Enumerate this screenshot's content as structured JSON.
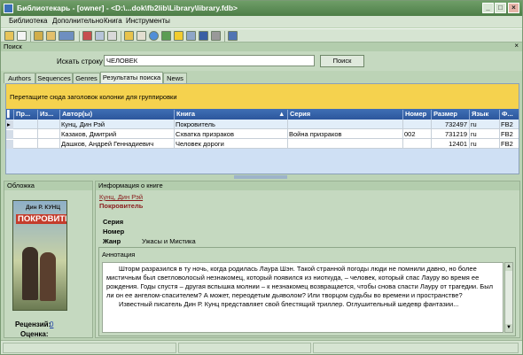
{
  "window": {
    "title": "Библиотекарь - [owner] - <D:\\...dok\\fb2lib\\Library\\library.fdb>",
    "minimize": "_",
    "maximize": "□",
    "close": "×"
  },
  "menu": [
    "Библиотека",
    "Дополнительно",
    "Книга",
    "Инструменты"
  ],
  "search": {
    "header": "Поиск",
    "close": "×",
    "label": "Искать строку",
    "value": "ЧЕЛОВЕК",
    "button": "Поиск"
  },
  "tabs": [
    "Authors",
    "Sequences",
    "Genres",
    "Результаты поиска",
    "News"
  ],
  "active_tab": 3,
  "grid": {
    "group_hint": "Перетащите сюда заголовок колонки для группировки",
    "columns": [
      "Пр...",
      "Из...",
      "Автор(ы)",
      "Книга",
      "Серия",
      "Номер",
      "Размер",
      "Язык",
      "Ф..."
    ],
    "rows": [
      {
        "author": "Кунц, Дин Рэй",
        "book": "Покровитель",
        "series": "",
        "number": "",
        "size": "732497",
        "lang": "ru",
        "format": "FB2"
      },
      {
        "author": "Казаков, Дмитрий",
        "book": "Схватка призраков",
        "series": "Война призраков",
        "number": "002",
        "size": "731219",
        "lang": "ru",
        "format": "FB2"
      },
      {
        "author": "Дашков, Андрей Геннадиевич",
        "book": "Человек дороги",
        "series": "",
        "number": "",
        "size": "12401",
        "lang": "ru",
        "format": "FB2"
      }
    ]
  },
  "cover": {
    "header": "Обложка",
    "image_author": "Дин Р. КУНЦ",
    "image_title": "ПОКРОВИТЕЛЬ",
    "reviews_label": "Рецензий:",
    "reviews_value": "0",
    "rating_label": "Оценка:"
  },
  "info": {
    "header": "Информация о книге",
    "author": "Кунц, Дин Рэй",
    "title": "Покровитель",
    "series_label": "Серия",
    "number_label": "Номер",
    "genre_label": "Жанр",
    "genre_value": "Ужасы и Мистика",
    "annotation_header": "Аннотация",
    "annotation_p1": "Шторм разразился в ту ночь, когда родилась Лаура Шэн. Такой странной погоды люди не помнили давно, но более мистичным был светловолосый незнакомец, который появился из ниоткуда, – человек, который спас Лауру во время ее рождения. Годы спустя – другая вспышка молнии – к незнакомец возвращается, чтобы снова спасти Лауру от трагедии. Был ли он ее ангелом-спасителем? А может, переодетым дьяволом? Или творцом судьбы во времени и пространстве?",
    "annotation_p2": "Известный писатель Дин Р. Кунц представляет свой блестящий триллер. Оглушительный шедевр фантазии..."
  }
}
